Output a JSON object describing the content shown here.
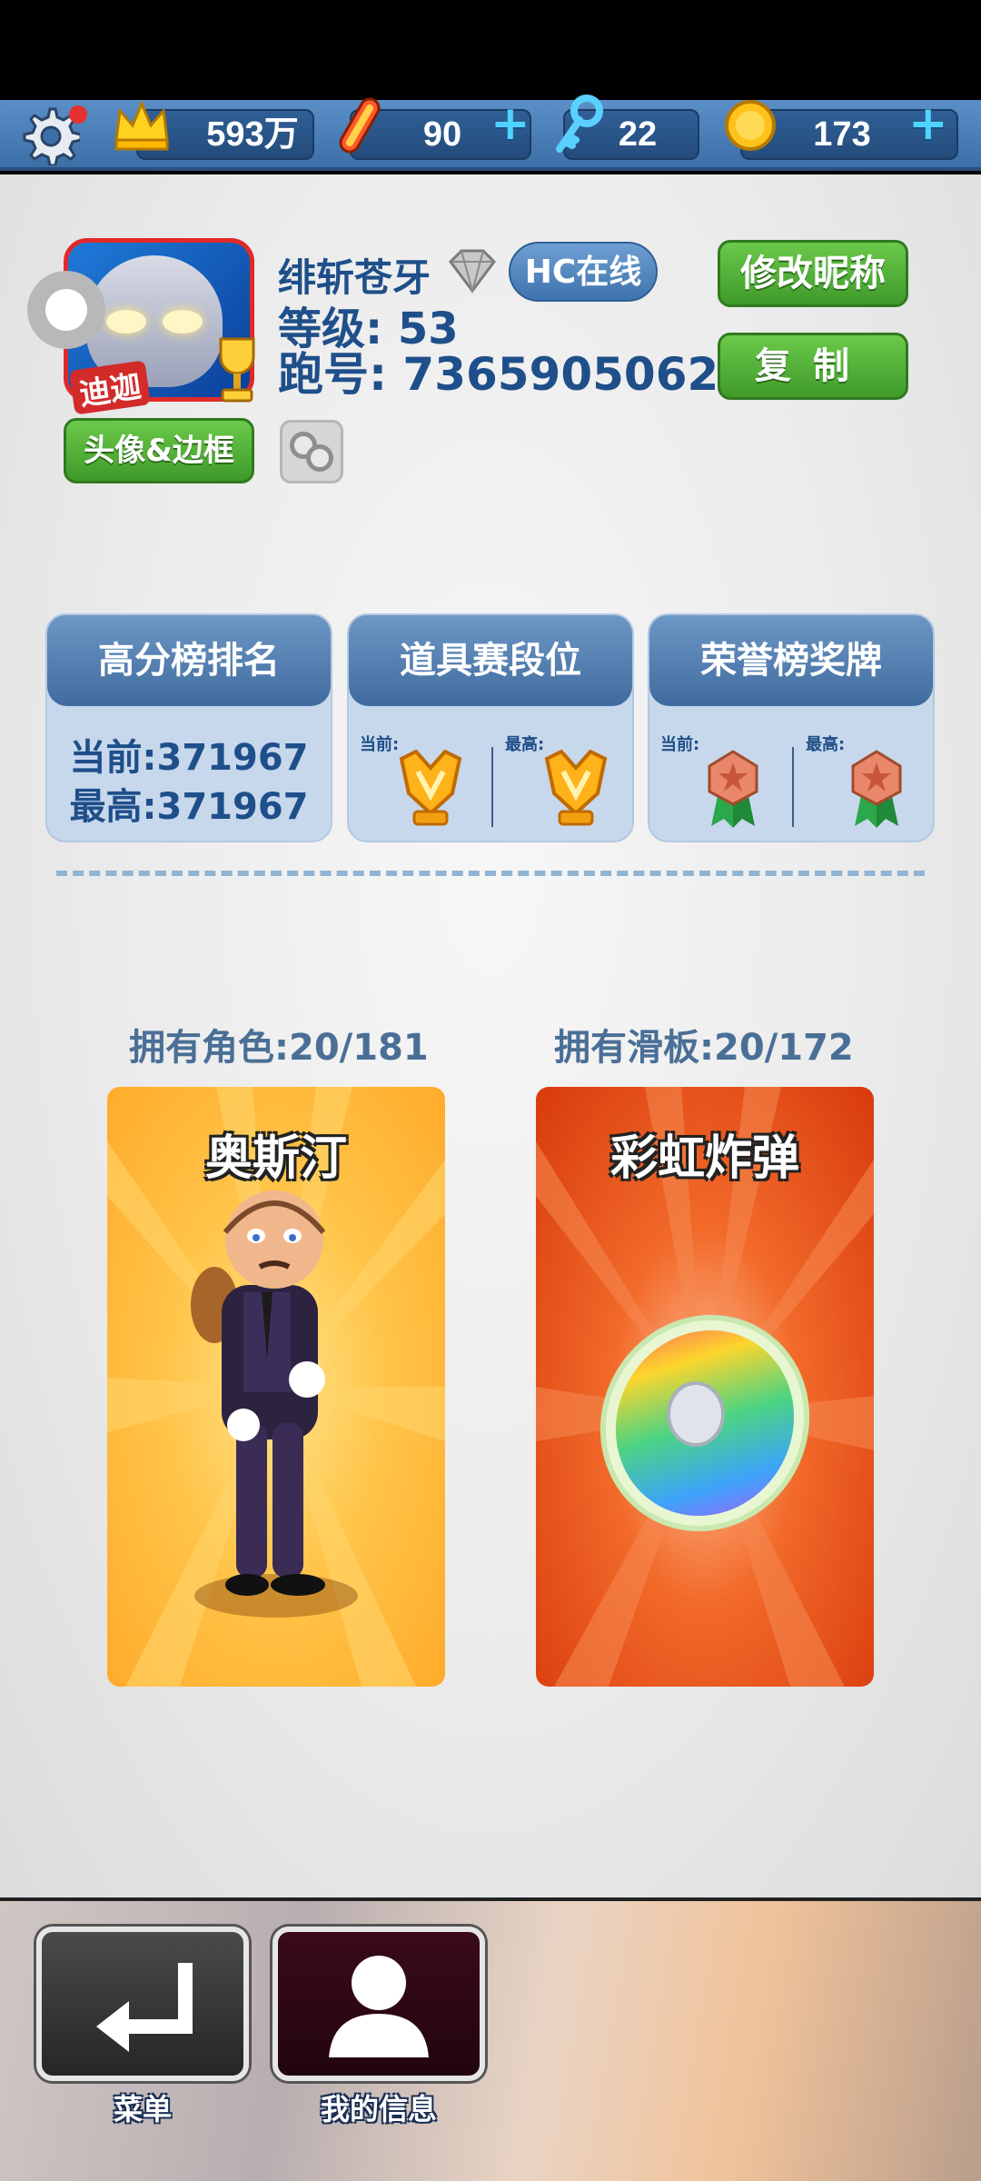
{
  "resources": {
    "crowns": "593万",
    "boards": "90",
    "keys": "22",
    "coins": "173"
  },
  "profile": {
    "avatar_tag": "迪迦",
    "name": "绯斩苍牙",
    "online_badge": "HC在线",
    "level": "等级: 53",
    "run_id": "跑号: 7365905062",
    "edit_name_label": "修改昵称",
    "copy_label": "复制",
    "avatar_frame_label": "头像&边框"
  },
  "stats": {
    "score_rank": {
      "title": "高分榜排名",
      "current": "当前:371967",
      "best": "最高:371967"
    },
    "item_tier": {
      "title": "道具赛段位",
      "current_label": "当前:",
      "best_label": "最高:"
    },
    "honor_medal": {
      "title": "荣誉榜奖牌",
      "current_label": "当前:",
      "best_label": "最高:"
    }
  },
  "collection": {
    "characters_label": "拥有角色:20/181",
    "boards_label": "拥有滑板:20/172",
    "character_name": "奥斯汀",
    "board_name": "彩虹炸弹"
  },
  "nav": {
    "menu_label": "菜单",
    "my_info_label": "我的信息"
  },
  "colors": {
    "accent_blue": "#1f4f8a",
    "green_button": "#4aaa32",
    "character_bg": "#ffb640",
    "board_bg": "#e24a12"
  }
}
